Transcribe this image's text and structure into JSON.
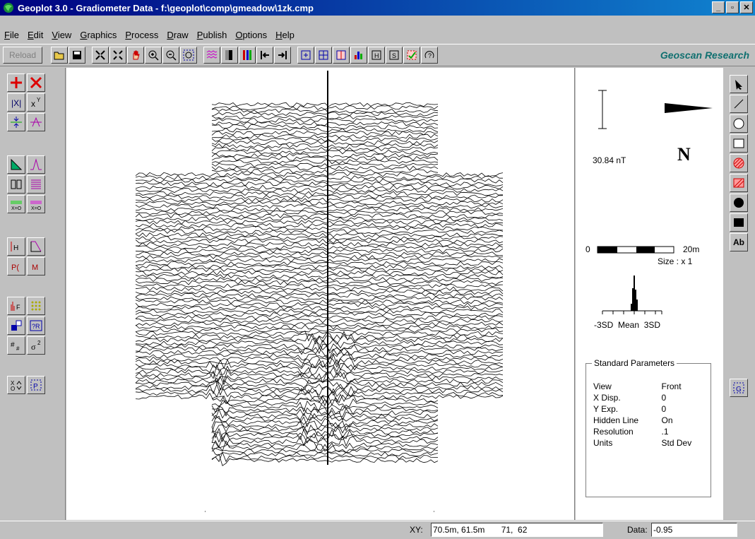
{
  "window": {
    "title": "Geoplot 3.0 - Gradiometer Data  -  f:\\geoplot\\comp\\gmeadow\\1zk.cmp",
    "minimize": "_",
    "maximize": "▫",
    "close": "✕"
  },
  "menu": [
    {
      "label": "File"
    },
    {
      "label": "Edit"
    },
    {
      "label": "View"
    },
    {
      "label": "Graphics"
    },
    {
      "label": "Process"
    },
    {
      "label": "Draw"
    },
    {
      "label": "Publish"
    },
    {
      "label": "Options"
    },
    {
      "label": "Help"
    }
  ],
  "toolbar": {
    "reload_label": "Reload",
    "brand": "Geoscan Research"
  },
  "info": {
    "scale_value": "30.84 nT",
    "north": "N",
    "scale_start": "0",
    "scale_end": "20m",
    "size": "Size : x 1",
    "hist_labels": "-3SD  Mean  3SD",
    "params_title": "Standard Parameters",
    "params": [
      {
        "key": "View",
        "value": "Front"
      },
      {
        "key": "X Disp.",
        "value": "0"
      },
      {
        "key": "Y Exp.",
        "value": "0"
      },
      {
        "key": "Hidden Line",
        "value": "On"
      },
      {
        "key": "Resolution",
        "value": ".1"
      },
      {
        "key": "Units",
        "value": "Std Dev"
      }
    ]
  },
  "right_tools": {
    "text_tool": "Ab",
    "grid_tool": "G"
  },
  "status": {
    "xy_label": "XY:",
    "xy_value": "70.5m, 61.5m       71,  62",
    "data_label": "Data:",
    "data_value": "-0.95"
  }
}
